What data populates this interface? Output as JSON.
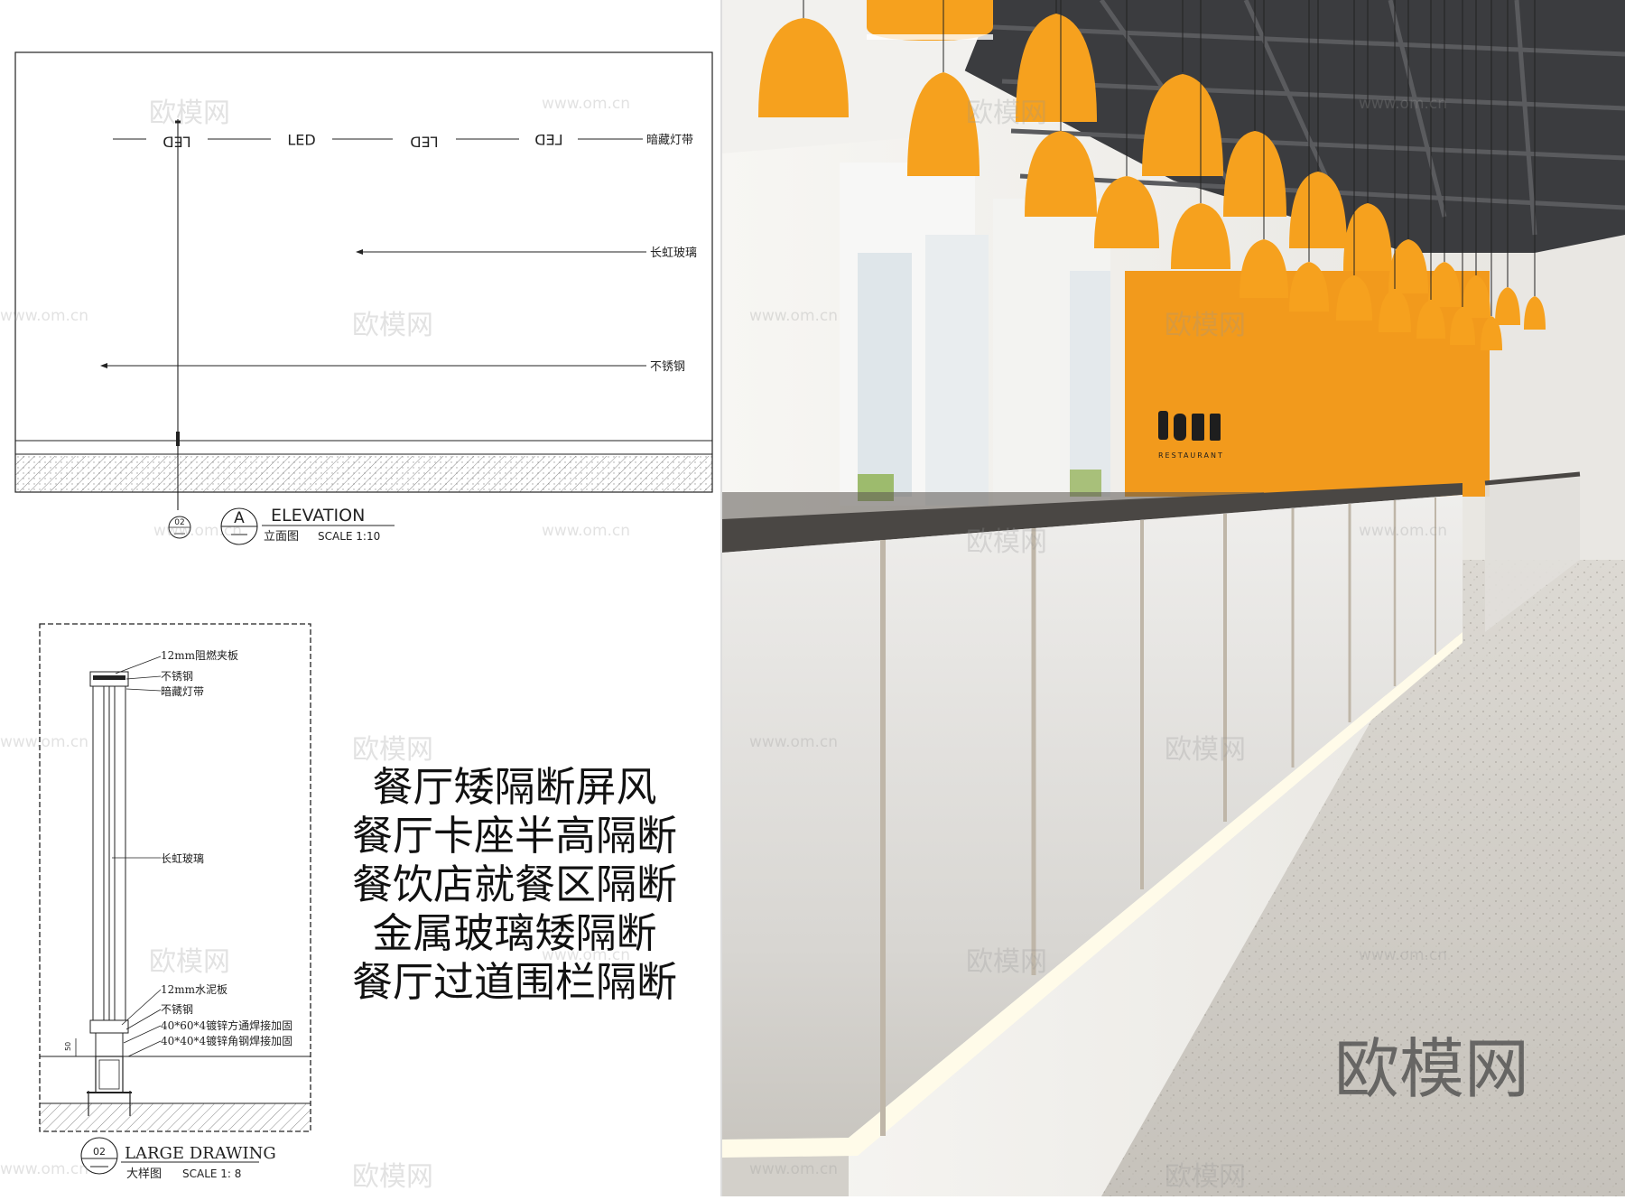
{
  "elevation": {
    "led_labels": [
      "LED",
      "LED",
      "LED",
      "LED"
    ],
    "callouts": {
      "hidden_light_strip": "暗藏灯带",
      "changhong_glass": "长虹玻璃",
      "stainless_steel": "不锈钢"
    },
    "title": "ELEVATION",
    "subtitle_cn": "立面图",
    "scale": "SCALE  1:10",
    "section_marker": "A",
    "ref_number": "02"
  },
  "large_drawing": {
    "labels": {
      "top_board": "12mm阻燃夹板",
      "stainless_top": "不锈钢",
      "light_strip": "暗藏灯带",
      "glass": "长虹玻璃",
      "cement_board": "12mm水泥板",
      "stainless_bottom": "不锈钢",
      "tube": "40*60*4镀锌方通焊接加固",
      "angle": "40*40*4镀锌角钢焊接加固"
    },
    "dimension": "50",
    "marker": "02",
    "title": "LARGE DRAWING",
    "subtitle_cn": "大样图",
    "scale": "SCALE  1: 8"
  },
  "titles": [
    "餐厅矮隔断屏风",
    "餐厅卡座半高隔断",
    "餐饮店就餐区隔断",
    "金属玻璃矮隔断",
    "餐厅过道围栏隔断"
  ],
  "render": {
    "restaurant_sign": "RESTAURANT",
    "brand_watermark": "欧模网"
  },
  "watermarks": {
    "brand": "欧模网",
    "url": "www.om.cn"
  },
  "colors": {
    "orange_wall": "#f29a1c",
    "lamp_orange": "#f6a11e",
    "ceiling_dark": "#3a3b3d",
    "floor": "#cfccc6"
  }
}
